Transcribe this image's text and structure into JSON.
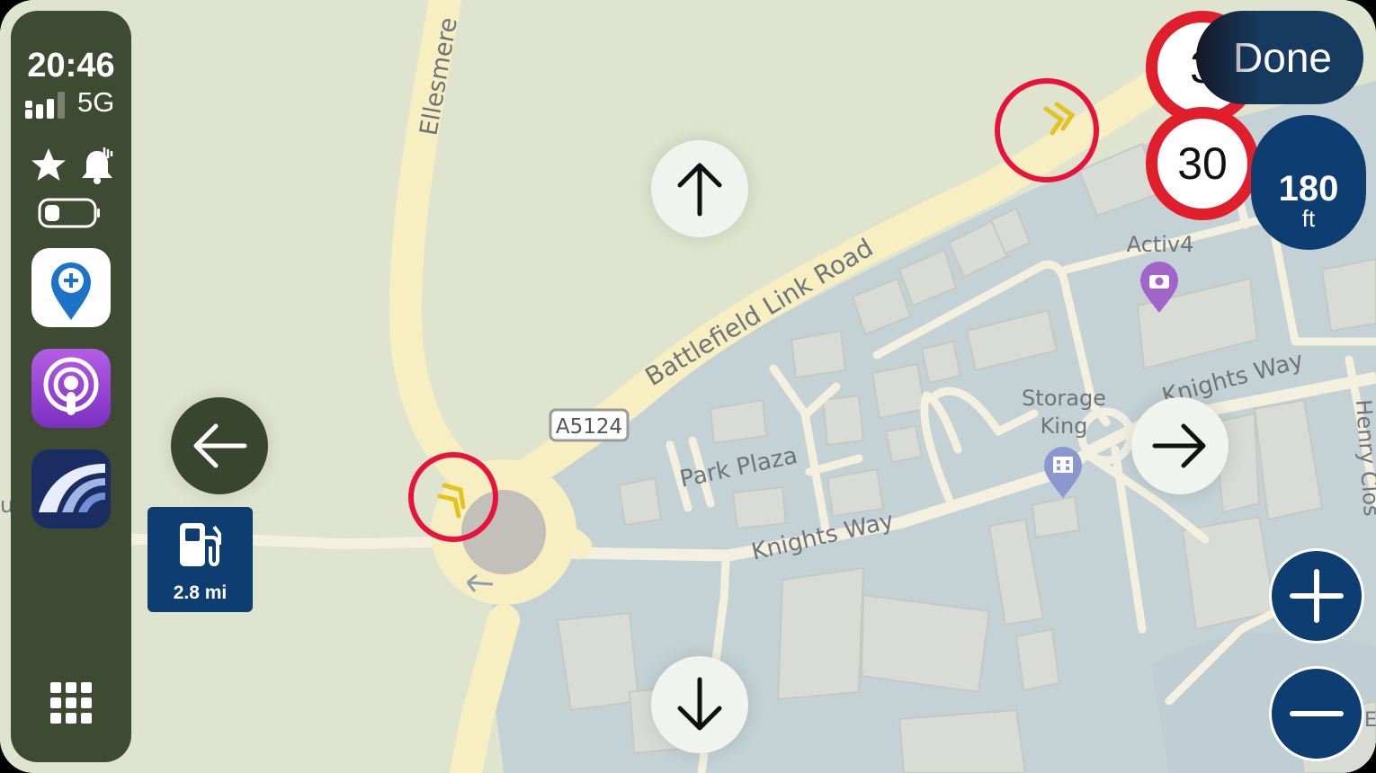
{
  "status": {
    "time": "20:46",
    "network": "5G",
    "battery_level": 0.15
  },
  "sidebar": {
    "apps": [
      {
        "name": "map-pin-app",
        "icon": "map-pin-plus-icon"
      },
      {
        "name": "podcasts-app",
        "icon": "podcasts-icon"
      },
      {
        "name": "navigation-app",
        "icon": "road-icon"
      }
    ],
    "grid_icon": "app-grid-icon"
  },
  "map": {
    "roads": [
      "Ellesmere",
      "Battlefield Link Road",
      "Park Plaza",
      "Knights Way",
      "Knights Way",
      "Henry Clos"
    ],
    "road_ref": "A5124",
    "pois": [
      {
        "label": "Activ4",
        "icon": "camera-icon",
        "color": "#a364c9"
      },
      {
        "label_line1": "Storage",
        "label_line2": "King",
        "icon": "building-icon",
        "color": "#8d97cf"
      }
    ],
    "edge_label_left": "u",
    "edge_label_right": "E"
  },
  "controls": {
    "done_label": "Done",
    "speed_limits": [
      "3",
      "30"
    ],
    "distance_value": "180",
    "distance_unit": "ft",
    "fuel_distance": "2.8 mi",
    "pan_icons": [
      "arrow-up-icon",
      "arrow-down-icon",
      "arrow-left-icon",
      "arrow-right-icon"
    ],
    "zoom_icons": [
      "plus-icon",
      "minus-icon"
    ]
  },
  "colors": {
    "speed_ring": "#e01e2c",
    "navy": "#0e3d71",
    "sidebar": "#3f4a33",
    "road": "#f7efc2"
  }
}
